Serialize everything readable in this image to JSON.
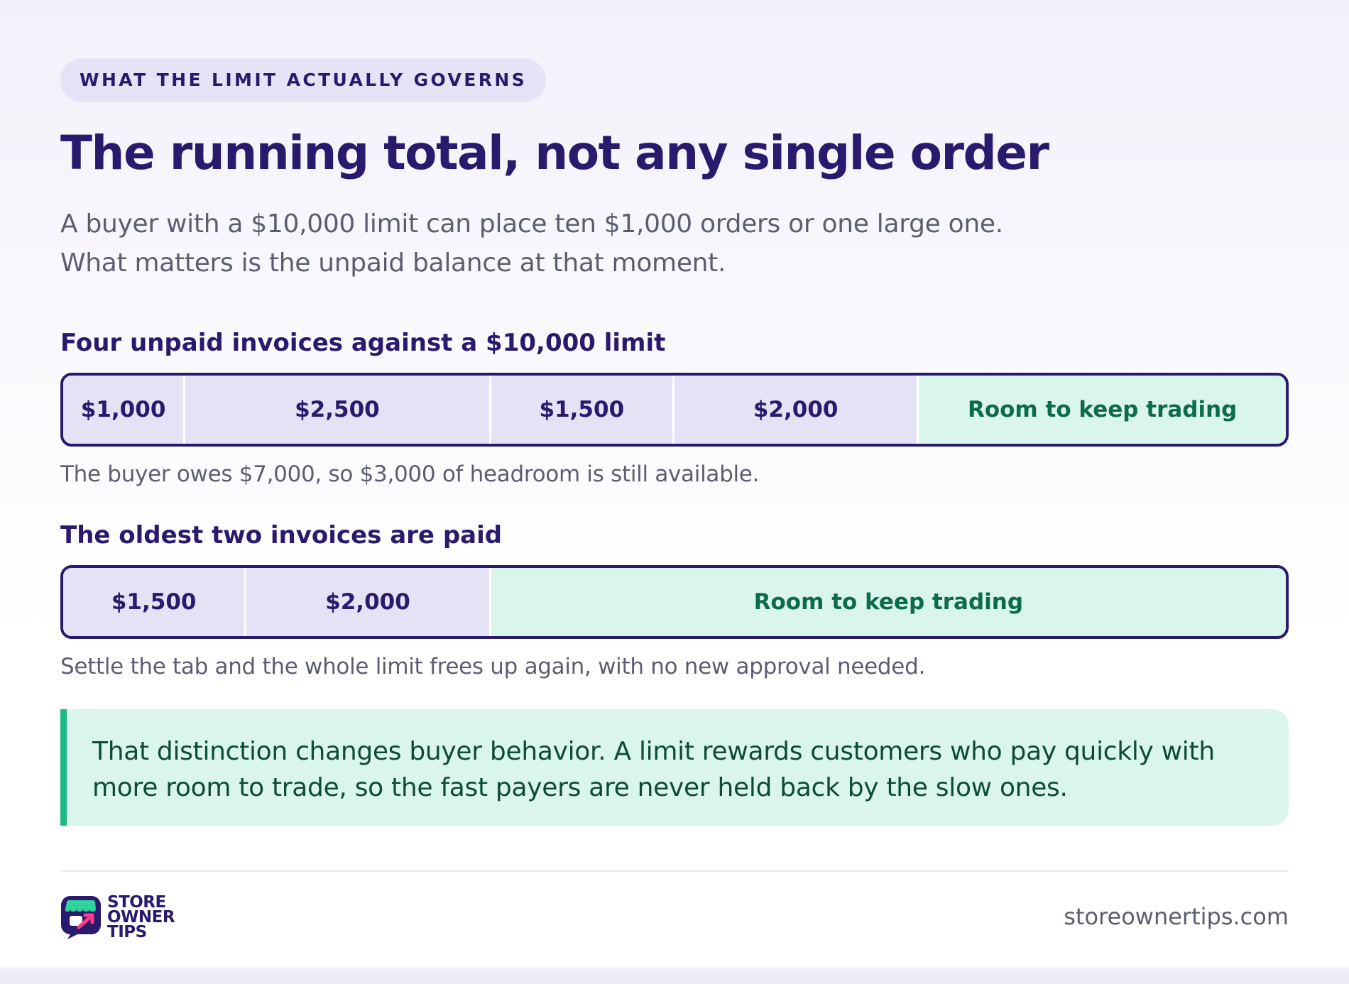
{
  "eyebrow": "WHAT THE LIMIT ACTUALLY GOVERNS",
  "title": "The running total, not any single order",
  "intro": "A buyer with a $10,000 limit can place ten $1,000 orders or one large one. What matters is the unpaid balance at that moment.",
  "colors": {
    "primary": "#2a1a6e",
    "invoice_fill": "#e6e2f6",
    "room_fill": "#daf5ec",
    "room_text": "#0d6b4d",
    "callout_accent": "#1db887"
  },
  "chart_data": [
    {
      "type": "bar",
      "stacked": true,
      "title": "Four unpaid invoices against a $10,000 limit",
      "limit": 10000,
      "segments": [
        {
          "label": "$1,000",
          "value": 1000,
          "kind": "invoice"
        },
        {
          "label": "$2,500",
          "value": 2500,
          "kind": "invoice"
        },
        {
          "label": "$1,500",
          "value": 1500,
          "kind": "invoice"
        },
        {
          "label": "$2,000",
          "value": 2000,
          "kind": "invoice"
        },
        {
          "label": "Room to keep trading",
          "value": 3000,
          "kind": "room"
        }
      ],
      "caption": "The buyer owes $7,000, so $3,000 of headroom is still available."
    },
    {
      "type": "bar",
      "stacked": true,
      "title": "The oldest two invoices are paid",
      "limit": 10000,
      "segments": [
        {
          "label": "$1,500",
          "value": 1500,
          "kind": "invoice"
        },
        {
          "label": "$2,000",
          "value": 2000,
          "kind": "invoice"
        },
        {
          "label": "Room to keep trading",
          "value": 6500,
          "kind": "room"
        }
      ],
      "caption": "Settle the tab and the whole limit frees up again, with no new approval needed."
    }
  ],
  "callout": "That distinction changes buyer behavior. A limit rewards customers who pay quickly with more room to trade, so the fast payers are never held back by the slow ones.",
  "footer": {
    "logo_line1": "STORE",
    "logo_line2": "OWNER",
    "logo_line3": "TIPS",
    "site": "storeownertips.com"
  }
}
